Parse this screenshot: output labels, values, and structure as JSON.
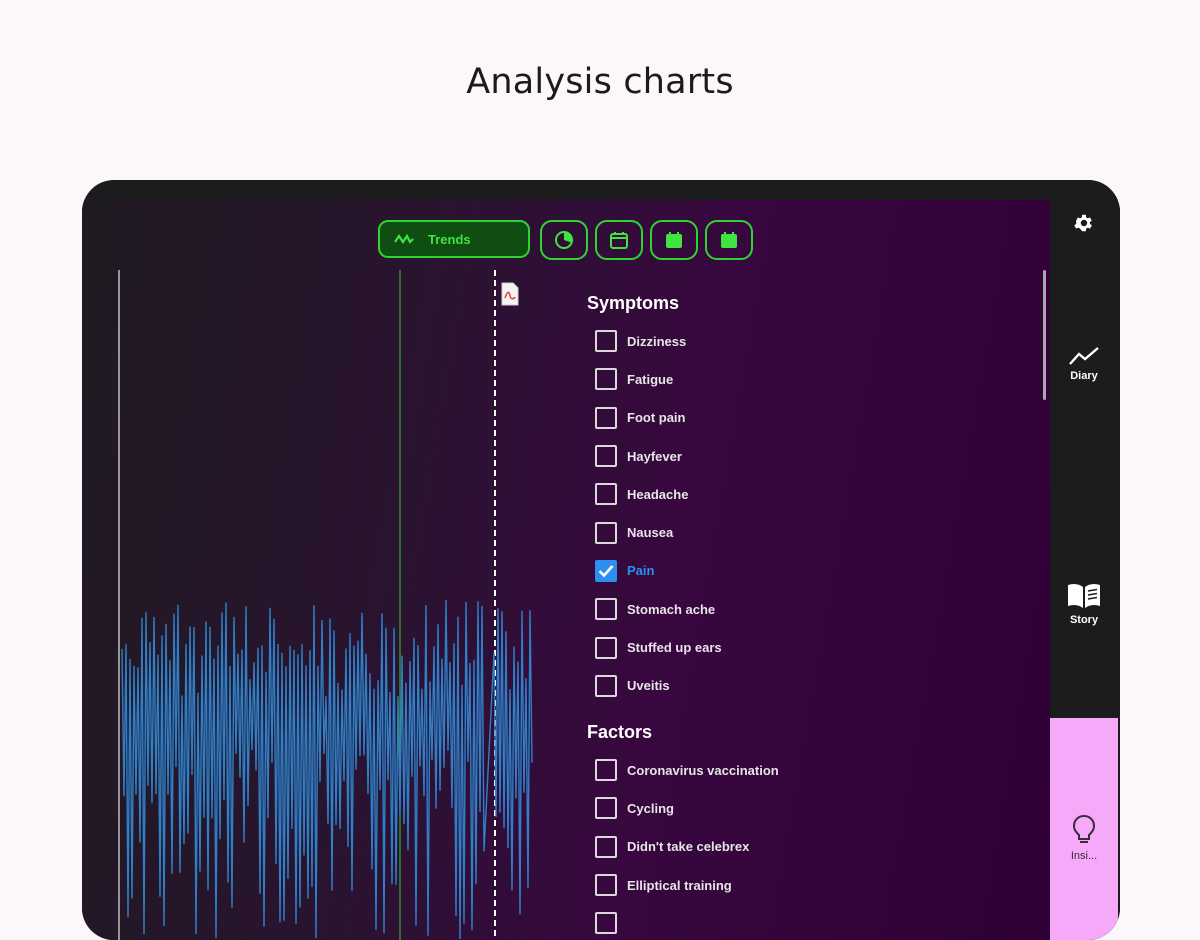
{
  "caption": "Analysis charts",
  "toolbar": {
    "active_tab_label": "Trends",
    "tabs": [
      "trends-wave-icon",
      "pie-chart-icon",
      "calendar-outline-icon",
      "calendar-filled-icon",
      "calendar-filled-icon"
    ],
    "accent": "#2fd42f"
  },
  "chart": {
    "series_color": "#2f7fc7",
    "marker_color": "#2fae2f"
  },
  "symptoms": {
    "title": "Symptoms",
    "items": [
      {
        "label": "Dizziness",
        "checked": false
      },
      {
        "label": "Fatigue",
        "checked": false
      },
      {
        "label": "Foot pain",
        "checked": false
      },
      {
        "label": "Hayfever",
        "checked": false
      },
      {
        "label": "Headache",
        "checked": false
      },
      {
        "label": "Nausea",
        "checked": false
      },
      {
        "label": "Pain",
        "checked": true
      },
      {
        "label": "Stomach ache",
        "checked": false
      },
      {
        "label": "Stuffed up ears",
        "checked": false
      },
      {
        "label": "Uveitis",
        "checked": false
      }
    ]
  },
  "factors": {
    "title": "Factors",
    "items": [
      {
        "label": "Coronavirus vaccination",
        "checked": false
      },
      {
        "label": "Cycling",
        "checked": false
      },
      {
        "label": "Didn't take celebrex",
        "checked": false
      },
      {
        "label": "Elliptical training",
        "checked": false
      }
    ]
  },
  "rail": {
    "diary_label": "Diary",
    "story_label": "Story",
    "insights_label": "Insi...",
    "active_color": "#f6a9f9"
  }
}
